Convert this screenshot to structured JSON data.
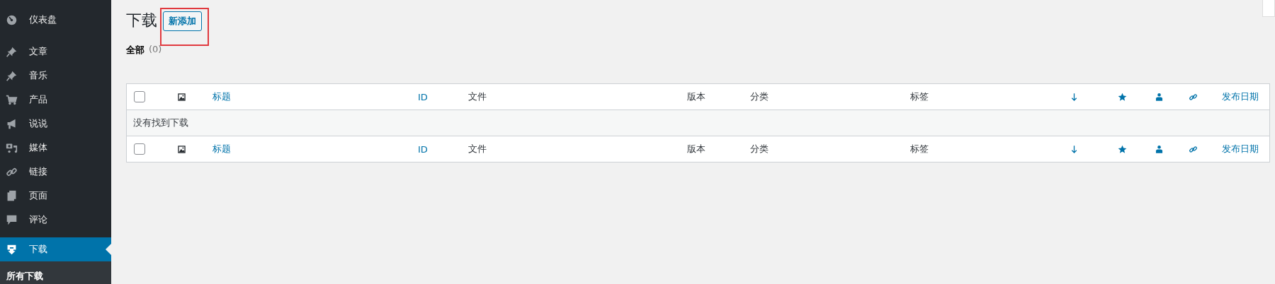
{
  "sidebar": {
    "items": [
      {
        "label": "仪表盘",
        "selected": false
      },
      {
        "label": "文章",
        "selected": false
      },
      {
        "label": "音乐",
        "selected": false
      },
      {
        "label": "产品",
        "selected": false
      },
      {
        "label": "说说",
        "selected": false
      },
      {
        "label": "媒体",
        "selected": false
      },
      {
        "label": "链接",
        "selected": false
      },
      {
        "label": "页面",
        "selected": false
      },
      {
        "label": "评论",
        "selected": false
      },
      {
        "label": "下载",
        "selected": true
      }
    ],
    "submenu": [
      {
        "label": "所有下载",
        "selected": true
      }
    ]
  },
  "page": {
    "title": "下载",
    "add_button": "新添加",
    "highlighted": true,
    "filters": [
      {
        "label": "全部",
        "count": "(0)"
      }
    ]
  },
  "table": {
    "columns": [
      {
        "kind": "checkbox",
        "checked": false
      },
      {
        "kind": "image"
      },
      {
        "kind": "text",
        "label": "标题",
        "sortable": true
      },
      {
        "kind": "text",
        "label": "ID",
        "sortable": true
      },
      {
        "kind": "text",
        "label": "文件",
        "sortable": false
      },
      {
        "kind": "text",
        "label": "版本",
        "sortable": false
      },
      {
        "kind": "text",
        "label": "分类",
        "sortable": false
      },
      {
        "kind": "text",
        "label": "标签",
        "sortable": false
      },
      {
        "kind": "arrow"
      },
      {
        "kind": "star"
      },
      {
        "kind": "person"
      },
      {
        "kind": "link"
      },
      {
        "kind": "text",
        "label": "发布日期",
        "sortable": true
      }
    ],
    "empty_message": "没有找到下载",
    "footer_columns": [
      {
        "kind": "checkbox",
        "checked": false
      },
      {
        "kind": "image"
      },
      {
        "kind": "text",
        "label": "标题",
        "sortable": true
      },
      {
        "kind": "text",
        "label": "ID",
        "sortable": true
      },
      {
        "kind": "text",
        "label": "文件",
        "sortable": false
      },
      {
        "kind": "text",
        "label": "版本",
        "sortable": false
      },
      {
        "kind": "text",
        "label": "分类",
        "sortable": false
      },
      {
        "kind": "text",
        "label": "标签",
        "sortable": false
      },
      {
        "kind": "arrow"
      },
      {
        "kind": "star"
      },
      {
        "kind": "person"
      },
      {
        "kind": "link"
      },
      {
        "kind": "text",
        "label": "发布日期",
        "sortable": true
      }
    ]
  }
}
